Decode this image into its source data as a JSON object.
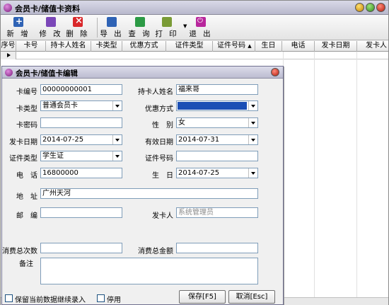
{
  "window": {
    "title": "会员卡/储值卡资料"
  },
  "toolbar": {
    "add": "新 增",
    "edit": "修 改",
    "delete": "删 除",
    "export": "导 出",
    "query": "查 询",
    "print": "打 印",
    "exit": "退 出"
  },
  "grid": {
    "columns": [
      "序号",
      "卡号",
      "持卡人姓名",
      "卡类型",
      "优惠方式",
      "证件类型",
      "证件号码",
      "生日",
      "电话",
      "发卡日期",
      "发卡人"
    ],
    "sort_glyph": "▲"
  },
  "dialog": {
    "title": "会员卡/储值卡编辑",
    "labels": {
      "card_no": "卡编号",
      "holder": "持卡人姓名",
      "card_type": "卡类型",
      "discount": "优惠方式",
      "password": "卡密码",
      "gender": "性　别",
      "issue_date": "发卡日期",
      "valid_date": "有效日期",
      "id_type": "证件类型",
      "id_no": "证件号码",
      "phone": "电　话",
      "birthday": "生　日",
      "address": "地　址",
      "postcode": "邮　编",
      "issuer": "发卡人",
      "consume_count": "消费总次数",
      "consume_amount": "消费总金额",
      "remark": "备注"
    },
    "values": {
      "card_no": "00000000001",
      "holder": "福来哥",
      "card_type": "普通会员卡",
      "discount": "",
      "password": "",
      "gender": "女",
      "issue_date": "2014-07-25",
      "valid_date": "2014-07-31",
      "id_type": "学生证",
      "id_no": "",
      "phone": "16800000",
      "birthday": "2014-07-25",
      "address": "广州天河",
      "postcode": "",
      "issuer": "系统管理员",
      "consume_count": "",
      "consume_amount": "",
      "remark": ""
    },
    "keep_label": "保留当前数据继续录入",
    "disable_label": "停用",
    "save_label": "保存[F5]",
    "cancel_label": "取消[Esc]"
  }
}
